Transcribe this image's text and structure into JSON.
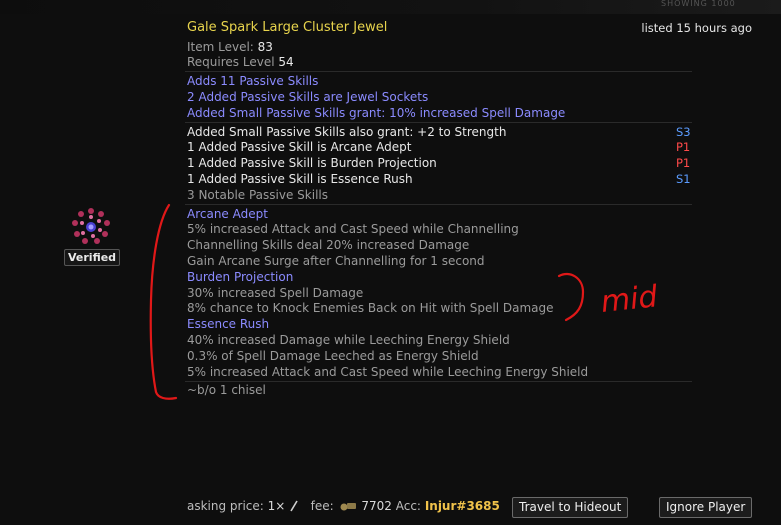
{
  "header_strip": "SHOWING 1000",
  "item": {
    "name": "Gale Spark Large Cluster Jewel",
    "listed": "listed 15 hours ago",
    "item_level_label": "Item Level: ",
    "item_level_value": "83",
    "requires_label": "Requires Level ",
    "requires_value": "54",
    "enchants": [
      "Adds 11 Passive Skills",
      "2 Added Passive Skills are Jewel Sockets",
      "Added Small Passive Skills grant: 10% increased Spell Damage"
    ],
    "explicits": [
      {
        "text": "Added Small Passive Skills also grant: +2 to Strength",
        "tier": "S3"
      },
      {
        "text": "1 Added Passive Skill is Arcane Adept",
        "tier": "P1"
      },
      {
        "text": "1 Added Passive Skill is Burden Projection",
        "tier": "P1"
      },
      {
        "text": "1 Added Passive Skill is Essence Rush",
        "tier": "S1"
      }
    ],
    "notable_count": "3 Notable Passive Skills",
    "notables": [
      {
        "name": "Arcane Adept",
        "lines": [
          "5% increased Attack and Cast Speed while Channelling",
          "Channelling Skills deal 20% increased Damage",
          "Gain Arcane Surge after Channelling for 1 second"
        ]
      },
      {
        "name": "Burden Projection",
        "lines": [
          "30% increased Spell Damage",
          "8% chance to Knock Enemies Back on Hit with Spell Damage"
        ]
      },
      {
        "name": "Essence Rush",
        "lines": [
          "40% increased Damage while Leeching Energy Shield",
          "0.3% of Spell Damage Leeched as Energy Shield",
          "5% increased Attack and Cast Speed while Leeching Energy Shield"
        ]
      }
    ],
    "note": "~b/o 1 chisel"
  },
  "seller": {
    "verified": "Verified",
    "asking_label": "asking price:",
    "asking_value": "1×",
    "fee_label": "fee:",
    "fee_value": "7702",
    "acc_label": "Acc:",
    "account": "Injur#3685"
  },
  "buttons": {
    "travel": "Travel to Hideout",
    "ignore": "Ignore Player"
  },
  "annotation": {
    "text": "mid",
    "color": "#e01818"
  },
  "colors": {
    "title": "#e8d44d",
    "magic_blue": "#8b8bff",
    "tier_suffix": "#5b9cff",
    "tier_prefix": "#ff4a4a",
    "account": "#f0c24a"
  }
}
